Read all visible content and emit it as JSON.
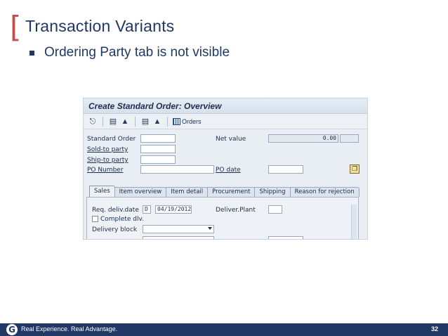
{
  "slide": {
    "bracket": "[",
    "title": "Transaction Variants",
    "bullet": "Ordering Party tab is not visible"
  },
  "sap": {
    "window_title": "Create Standard Order: Overview",
    "toolbar": {
      "orders_label": "Orders"
    },
    "labels": {
      "standard_order": "Standard Order",
      "sold_to": "Sold-to party",
      "ship_to": "Ship-to party",
      "po_number": "PO Number",
      "net_value": "Net value",
      "po_date": "PO date",
      "req_deliv_date": "Req. deliv.date",
      "deliver_plant": "Deliver.Plant",
      "complete_dlv": "Complete dlv.",
      "delivery_block": "Delivery block"
    },
    "values": {
      "net_value": "0.00",
      "date_format": "D",
      "req_deliv_date": "04/19/2012"
    },
    "tabs": [
      {
        "label": "Sales"
      },
      {
        "label": "Item overview"
      },
      {
        "label": "Item detail"
      },
      {
        "label": "Procurement"
      },
      {
        "label": "Shipping"
      },
      {
        "label": "Reason for rejection"
      }
    ]
  },
  "footer": {
    "logo_letter": "G",
    "tagline": "Real Experience. Real Advantage.",
    "page_number": "32"
  },
  "colors": {
    "navy": "#1f3864",
    "bracket_red": "#c0504d",
    "sap_bg": "#e9eef5"
  }
}
